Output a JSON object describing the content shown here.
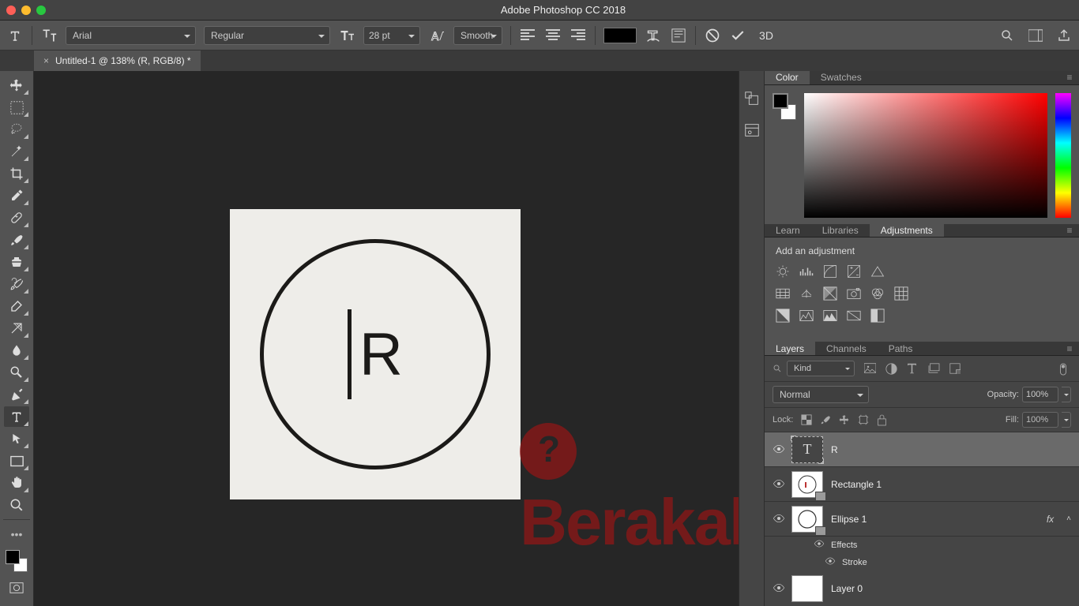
{
  "app_title": "Adobe Photoshop CC 2018",
  "document_tab": "Untitled-1 @ 138% (R, RGB/8) *",
  "options": {
    "font_family": "Arial",
    "font_weight": "Regular",
    "font_size": "28 pt",
    "antialias": "Smooth"
  },
  "canvas": {
    "text": "R"
  },
  "panels": {
    "color_tabs": [
      "Color",
      "Swatches"
    ],
    "mid_tabs": [
      "Learn",
      "Libraries",
      "Adjustments"
    ],
    "adjustments_title": "Add an adjustment",
    "layer_tabs": [
      "Layers",
      "Channels",
      "Paths"
    ],
    "filter_kind": "Kind",
    "blend_mode": "Normal",
    "opacity_label": "Opacity:",
    "opacity_value": "100%",
    "fill_label": "Fill:",
    "fill_value": "100%",
    "lock_label": "Lock:",
    "layers": [
      {
        "name": "R",
        "type": "text",
        "selected": true
      },
      {
        "name": "Rectangle 1",
        "type": "shape"
      },
      {
        "name": "Ellipse 1",
        "type": "shape",
        "fx": true
      },
      {
        "name": "Layer 0",
        "type": "raster"
      }
    ],
    "effects_label": "Effects",
    "stroke_label": "Stroke"
  },
  "watermark": "Berakal.com"
}
